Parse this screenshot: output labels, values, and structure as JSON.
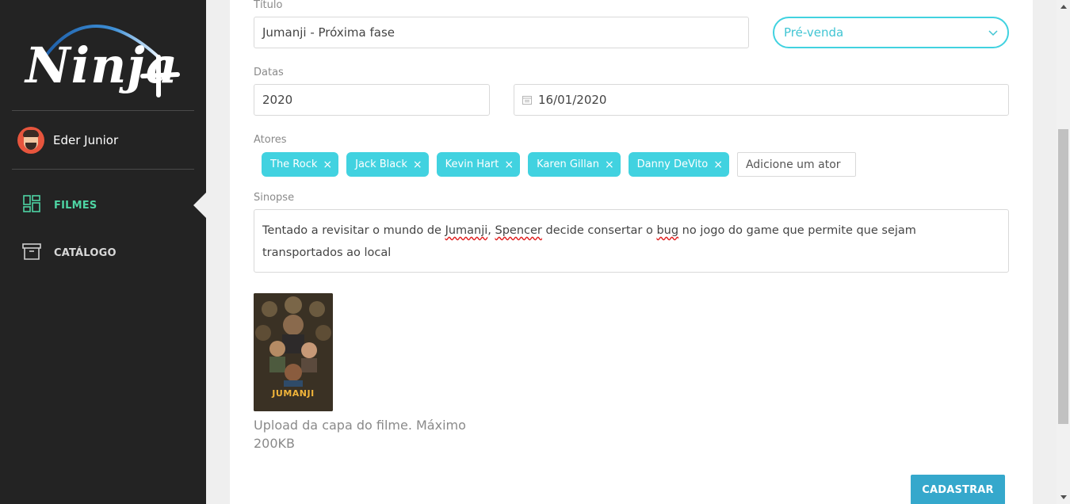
{
  "brand": {
    "logo_text": "Ninja+"
  },
  "user": {
    "name": "Eder Junior"
  },
  "nav": {
    "items": [
      {
        "label": "FILMES",
        "icon": "dashboard-icon",
        "active": true,
        "color": "#4ed4a3"
      },
      {
        "label": "CATÁLOGO",
        "icon": "archive-box-icon",
        "active": false
      }
    ]
  },
  "form": {
    "title": {
      "label": "Título",
      "value": "Jumanji - Próxima fase"
    },
    "status": {
      "value": "Pré-venda",
      "accent": "#41d2e0"
    },
    "dates": {
      "label": "Datas",
      "year": "2020",
      "release_date": "16/01/2020"
    },
    "actors": {
      "label": "Atores",
      "items": [
        "The Rock",
        "Jack Black",
        "Kevin Hart",
        "Karen Gillan",
        "Danny DeVito"
      ],
      "remove_glyph": "×",
      "input_placeholder": "Adicione um ator"
    },
    "synopsis": {
      "label": "Sinopse",
      "parts": [
        "Tentado a revisitar o mundo de ",
        "Jumanji",
        ", ",
        "Spencer",
        " decide consertar o ",
        "bug",
        " no jogo do game que permite que sejam transportados ao local"
      ]
    },
    "cover": {
      "poster_title": "JUMANJI",
      "upload_help": "Upload da capa do filme. Máximo 200KB"
    },
    "submit_label": "CADASTRAR",
    "submit_color": "#35a8cc"
  }
}
